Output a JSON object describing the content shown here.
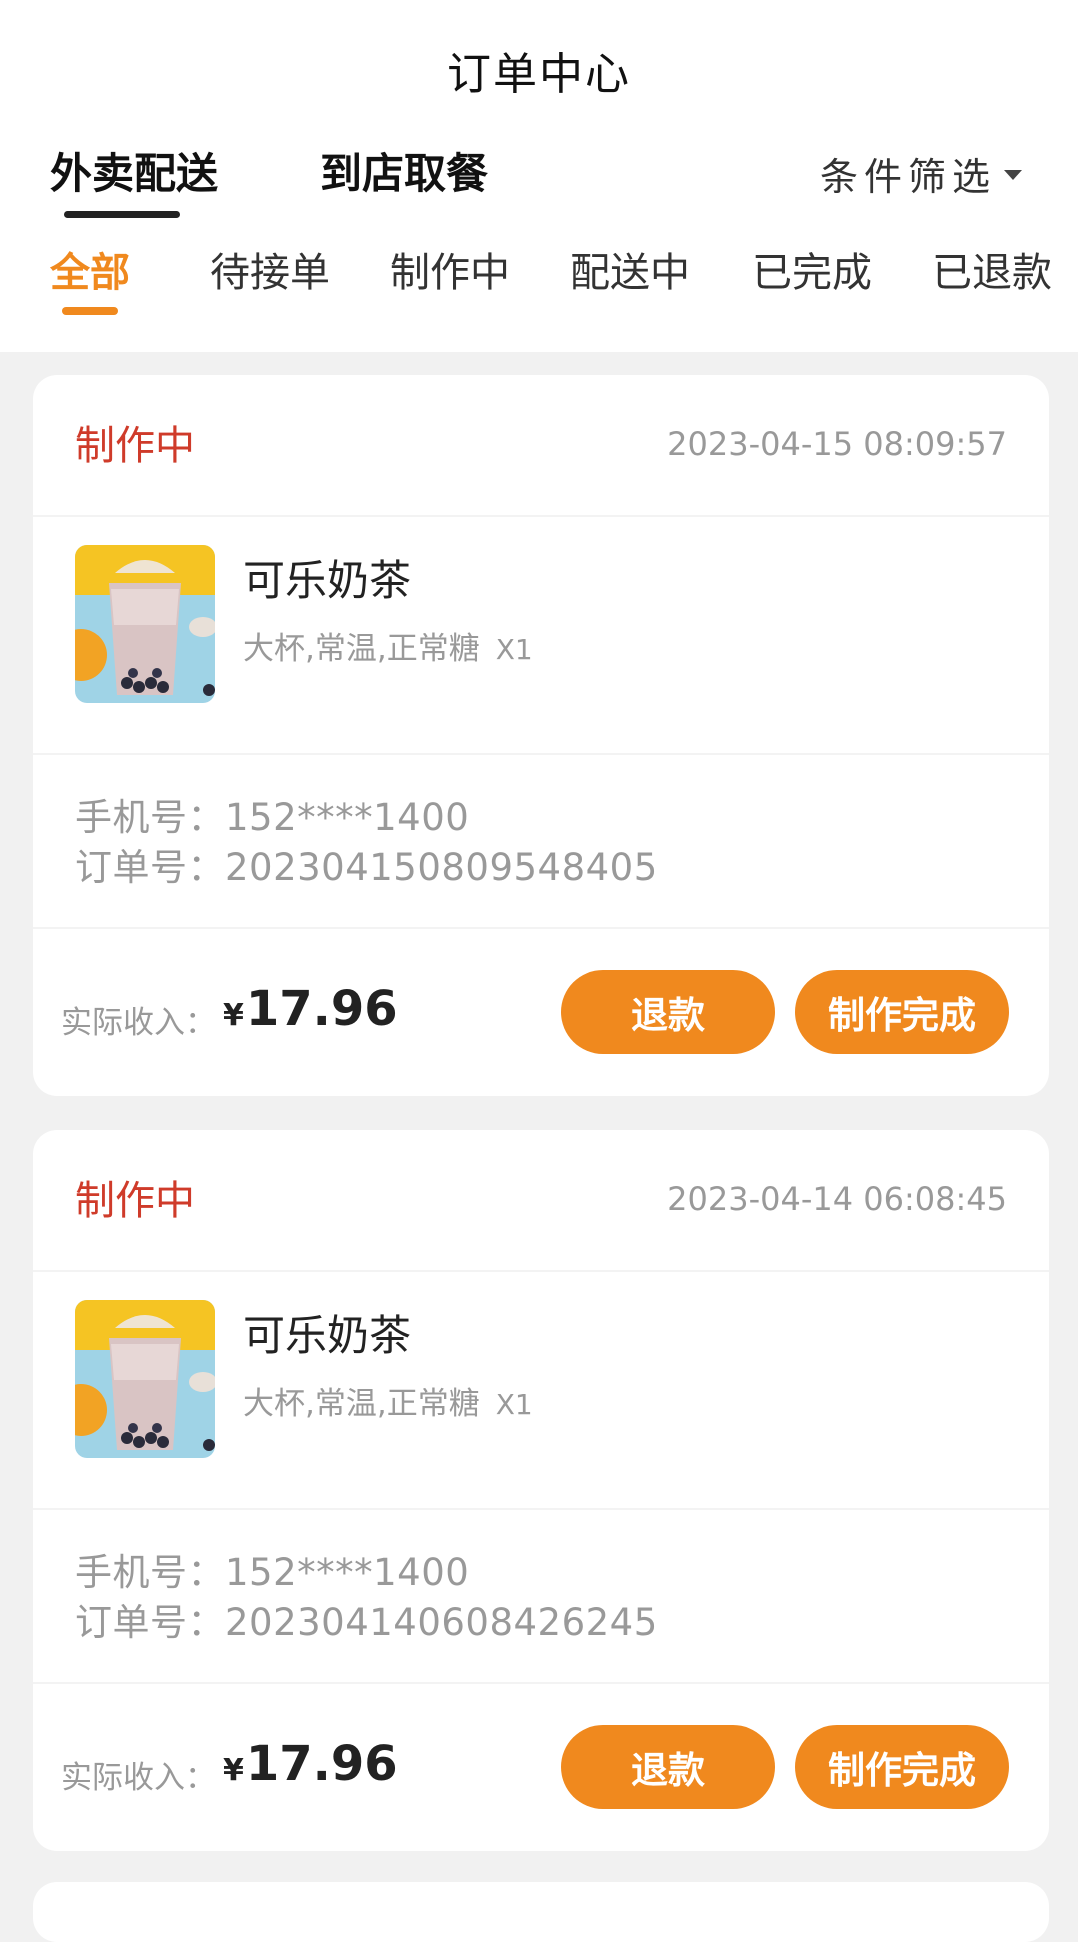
{
  "header": {
    "title": "订单中心",
    "mode_tabs": [
      {
        "label": "外卖配送",
        "active": true
      },
      {
        "label": "到店取餐",
        "active": false
      }
    ],
    "filter_label": "条件筛选"
  },
  "status_tabs": [
    {
      "label": "全部",
      "active": true
    },
    {
      "label": "待接单",
      "active": false
    },
    {
      "label": "制作中",
      "active": false
    },
    {
      "label": "配送中",
      "active": false
    },
    {
      "label": "已完成",
      "active": false
    },
    {
      "label": "已退款",
      "active": false
    }
  ],
  "colors": {
    "accent": "#f0891e",
    "status_text": "#cf3b2a",
    "muted": "#999999"
  },
  "orders": [
    {
      "status": "制作中",
      "time": "2023-04-15 08:09:57",
      "item": {
        "name": "可乐奶茶",
        "spec": "大杯,常温,正常糖",
        "qty": "X1"
      },
      "phone_label": "手机号：",
      "phone": "152****1400",
      "order_no_label": "订单号：",
      "order_no": "20230415080954840​5",
      "income_label": "实际收入：",
      "currency": "¥",
      "income": "17.96",
      "refund_label": "退款",
      "done_label": "制作完成"
    },
    {
      "status": "制作中",
      "time": "2023-04-14 06:08:45",
      "item": {
        "name": "可乐奶茶",
        "spec": "大杯,常温,正常糖",
        "qty": "X1"
      },
      "phone_label": "手机号：",
      "phone": "152****1400",
      "order_no_label": "订单号：",
      "order_no": "202304140608426245",
      "income_label": "实际收入：",
      "currency": "¥",
      "income": "17.96",
      "refund_label": "退款",
      "done_label": "制作完成"
    }
  ]
}
